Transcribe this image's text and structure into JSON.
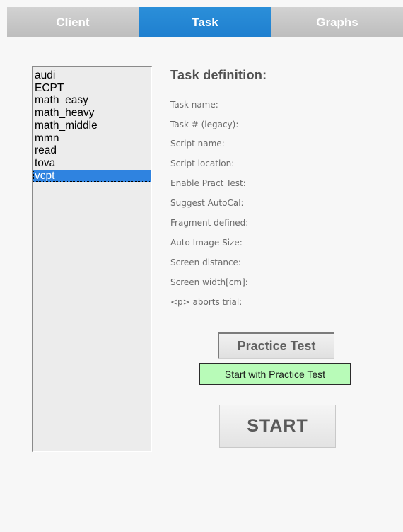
{
  "tabs": [
    {
      "label": "Client",
      "active": false
    },
    {
      "label": "Task",
      "active": true
    },
    {
      "label": "Graphs",
      "active": false
    }
  ],
  "tasks": {
    "items": [
      "audi",
      "ECPT",
      "math_easy",
      "math_heavy",
      "math_middle",
      "mmn",
      "read",
      "tova",
      "vcpt"
    ],
    "selected": "vcpt"
  },
  "task_definition": {
    "title": "Task definition:",
    "fields": [
      "Task name:",
      "Task # (legacy):",
      "Script name:",
      "Script location:",
      "Enable Pract Test:",
      "Suggest AutoCal:",
      "Fragment defined:",
      "Auto Image Size:",
      "Screen distance:",
      "Screen width[cm]:",
      "<p> aborts trial:"
    ]
  },
  "buttons": {
    "practice_test": "Practice Test",
    "start_with_practice": "Start with Practice Test",
    "start": "START"
  },
  "colors": {
    "tab_active": "#2088d4",
    "tab_inactive": "#c7c7c7",
    "selection": "#2f83e0",
    "toggle_on": "#b8fbb8"
  }
}
